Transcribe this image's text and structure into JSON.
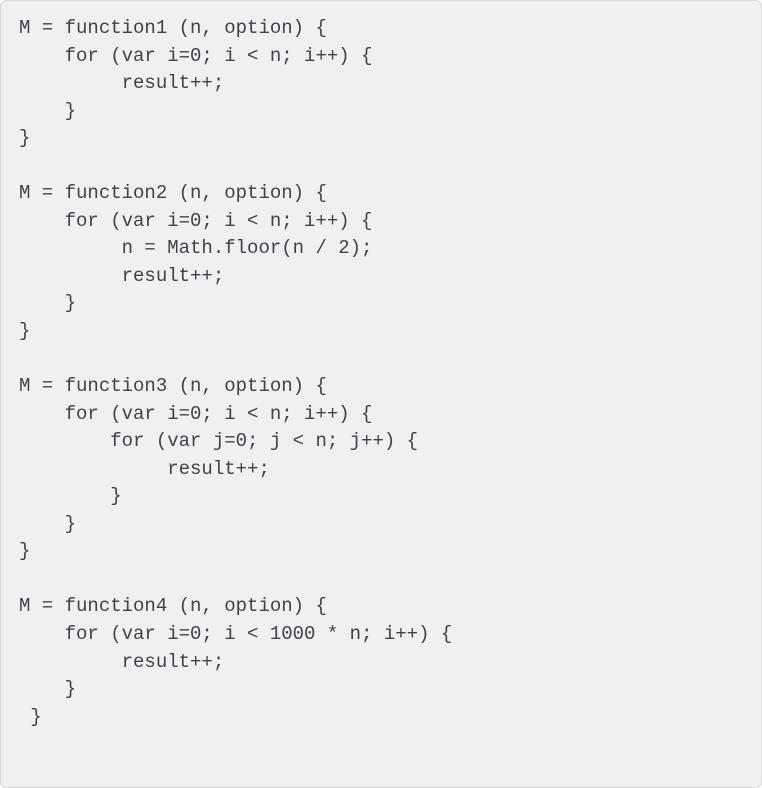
{
  "code": {
    "l0": "M = function1 (n, option) {",
    "l1": "    for (var i=0; i < n; i++) {",
    "l2": "         result++;",
    "l3": "    }",
    "l4": "}",
    "l5": "",
    "l6": "M = function2 (n, option) {",
    "l7": "    for (var i=0; i < n; i++) {",
    "l8": "         n = Math.floor(n / 2);",
    "l9": "         result++;",
    "l10": "    }",
    "l11": "}",
    "l12": "",
    "l13": "M = function3 (n, option) {",
    "l14": "    for (var i=0; i < n; i++) {",
    "l15": "        for (var j=0; j < n; j++) {",
    "l16": "             result++;",
    "l17": "        }",
    "l18": "    }",
    "l19": "}",
    "l20": "",
    "l21": "M = function4 (n, option) {",
    "l22": "    for (var i=0; i < 1000 * n; i++) {",
    "l23": "         result++;",
    "l24": "    }",
    "l25": " }"
  }
}
